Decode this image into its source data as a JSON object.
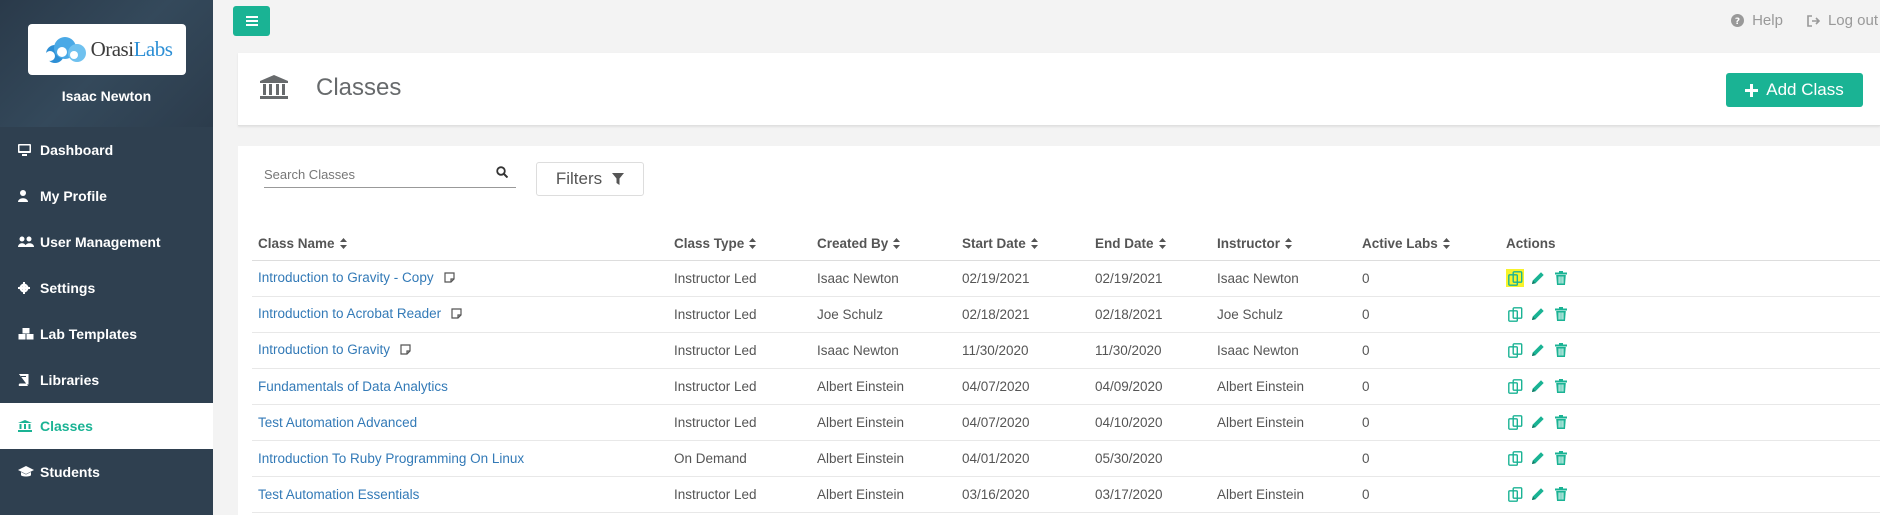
{
  "sidebar": {
    "logo": {
      "part1": "Orasi",
      "part2": "Labs"
    },
    "user_name": "Isaac Newton",
    "items": [
      {
        "label": "Dashboard",
        "icon": "monitor-icon"
      },
      {
        "label": "My Profile",
        "icon": "user-icon"
      },
      {
        "label": "User Management",
        "icon": "users-icon"
      },
      {
        "label": "Settings",
        "icon": "gear-icon"
      },
      {
        "label": "Lab Templates",
        "icon": "cubes-icon"
      },
      {
        "label": "Libraries",
        "icon": "book-icon"
      },
      {
        "label": "Classes",
        "icon": "institution-icon",
        "active": true
      },
      {
        "label": "Students",
        "icon": "graduation-cap-icon"
      }
    ]
  },
  "topbar": {
    "help": "Help",
    "logout": "Log out"
  },
  "header": {
    "title": "Classes",
    "add_button": "Add Class"
  },
  "search": {
    "placeholder": "Search Classes"
  },
  "filters_label": "Filters",
  "table": {
    "columns": [
      "Class Name",
      "Class Type",
      "Created By",
      "Start Date",
      "End Date",
      "Instructor",
      "Active Labs",
      "Actions"
    ],
    "rows": [
      {
        "name": "Introduction to Gravity - Copy",
        "note": true,
        "type": "Instructor Led",
        "created_by": "Isaac Newton",
        "start": "02/19/2021",
        "end": "02/19/2021",
        "instructor": "Isaac Newton",
        "active_labs": "0",
        "highlight_copy": true
      },
      {
        "name": "Introduction to Acrobat Reader",
        "note": true,
        "type": "Instructor Led",
        "created_by": "Joe Schulz",
        "start": "02/18/2021",
        "end": "02/18/2021",
        "instructor": "Joe Schulz",
        "active_labs": "0"
      },
      {
        "name": "Introduction to Gravity",
        "note": true,
        "type": "Instructor Led",
        "created_by": "Isaac Newton",
        "start": "11/30/2020",
        "end": "11/30/2020",
        "instructor": "Isaac Newton",
        "active_labs": "0"
      },
      {
        "name": "Fundamentals of Data Analytics",
        "note": false,
        "type": "Instructor Led",
        "created_by": "Albert Einstein",
        "start": "04/07/2020",
        "end": "04/09/2020",
        "instructor": "Albert Einstein",
        "active_labs": "0"
      },
      {
        "name": "Test Automation Advanced",
        "note": false,
        "type": "Instructor Led",
        "created_by": "Albert Einstein",
        "start": "04/07/2020",
        "end": "04/10/2020",
        "instructor": "Albert Einstein",
        "active_labs": "0"
      },
      {
        "name": "Introduction To Ruby Programming On Linux",
        "note": false,
        "type": "On Demand",
        "created_by": "Albert Einstein",
        "start": "04/01/2020",
        "end": "05/30/2020",
        "instructor": "",
        "active_labs": "0"
      },
      {
        "name": "Test Automation Essentials",
        "note": false,
        "type": "Instructor Led",
        "created_by": "Albert Einstein",
        "start": "03/16/2020",
        "end": "03/17/2020",
        "instructor": "Albert Einstein",
        "active_labs": "0"
      }
    ]
  },
  "colors": {
    "accent": "#1ab394",
    "link": "#337ab7",
    "sidebar": "#2f4050",
    "highlight": "#f7f32a"
  }
}
